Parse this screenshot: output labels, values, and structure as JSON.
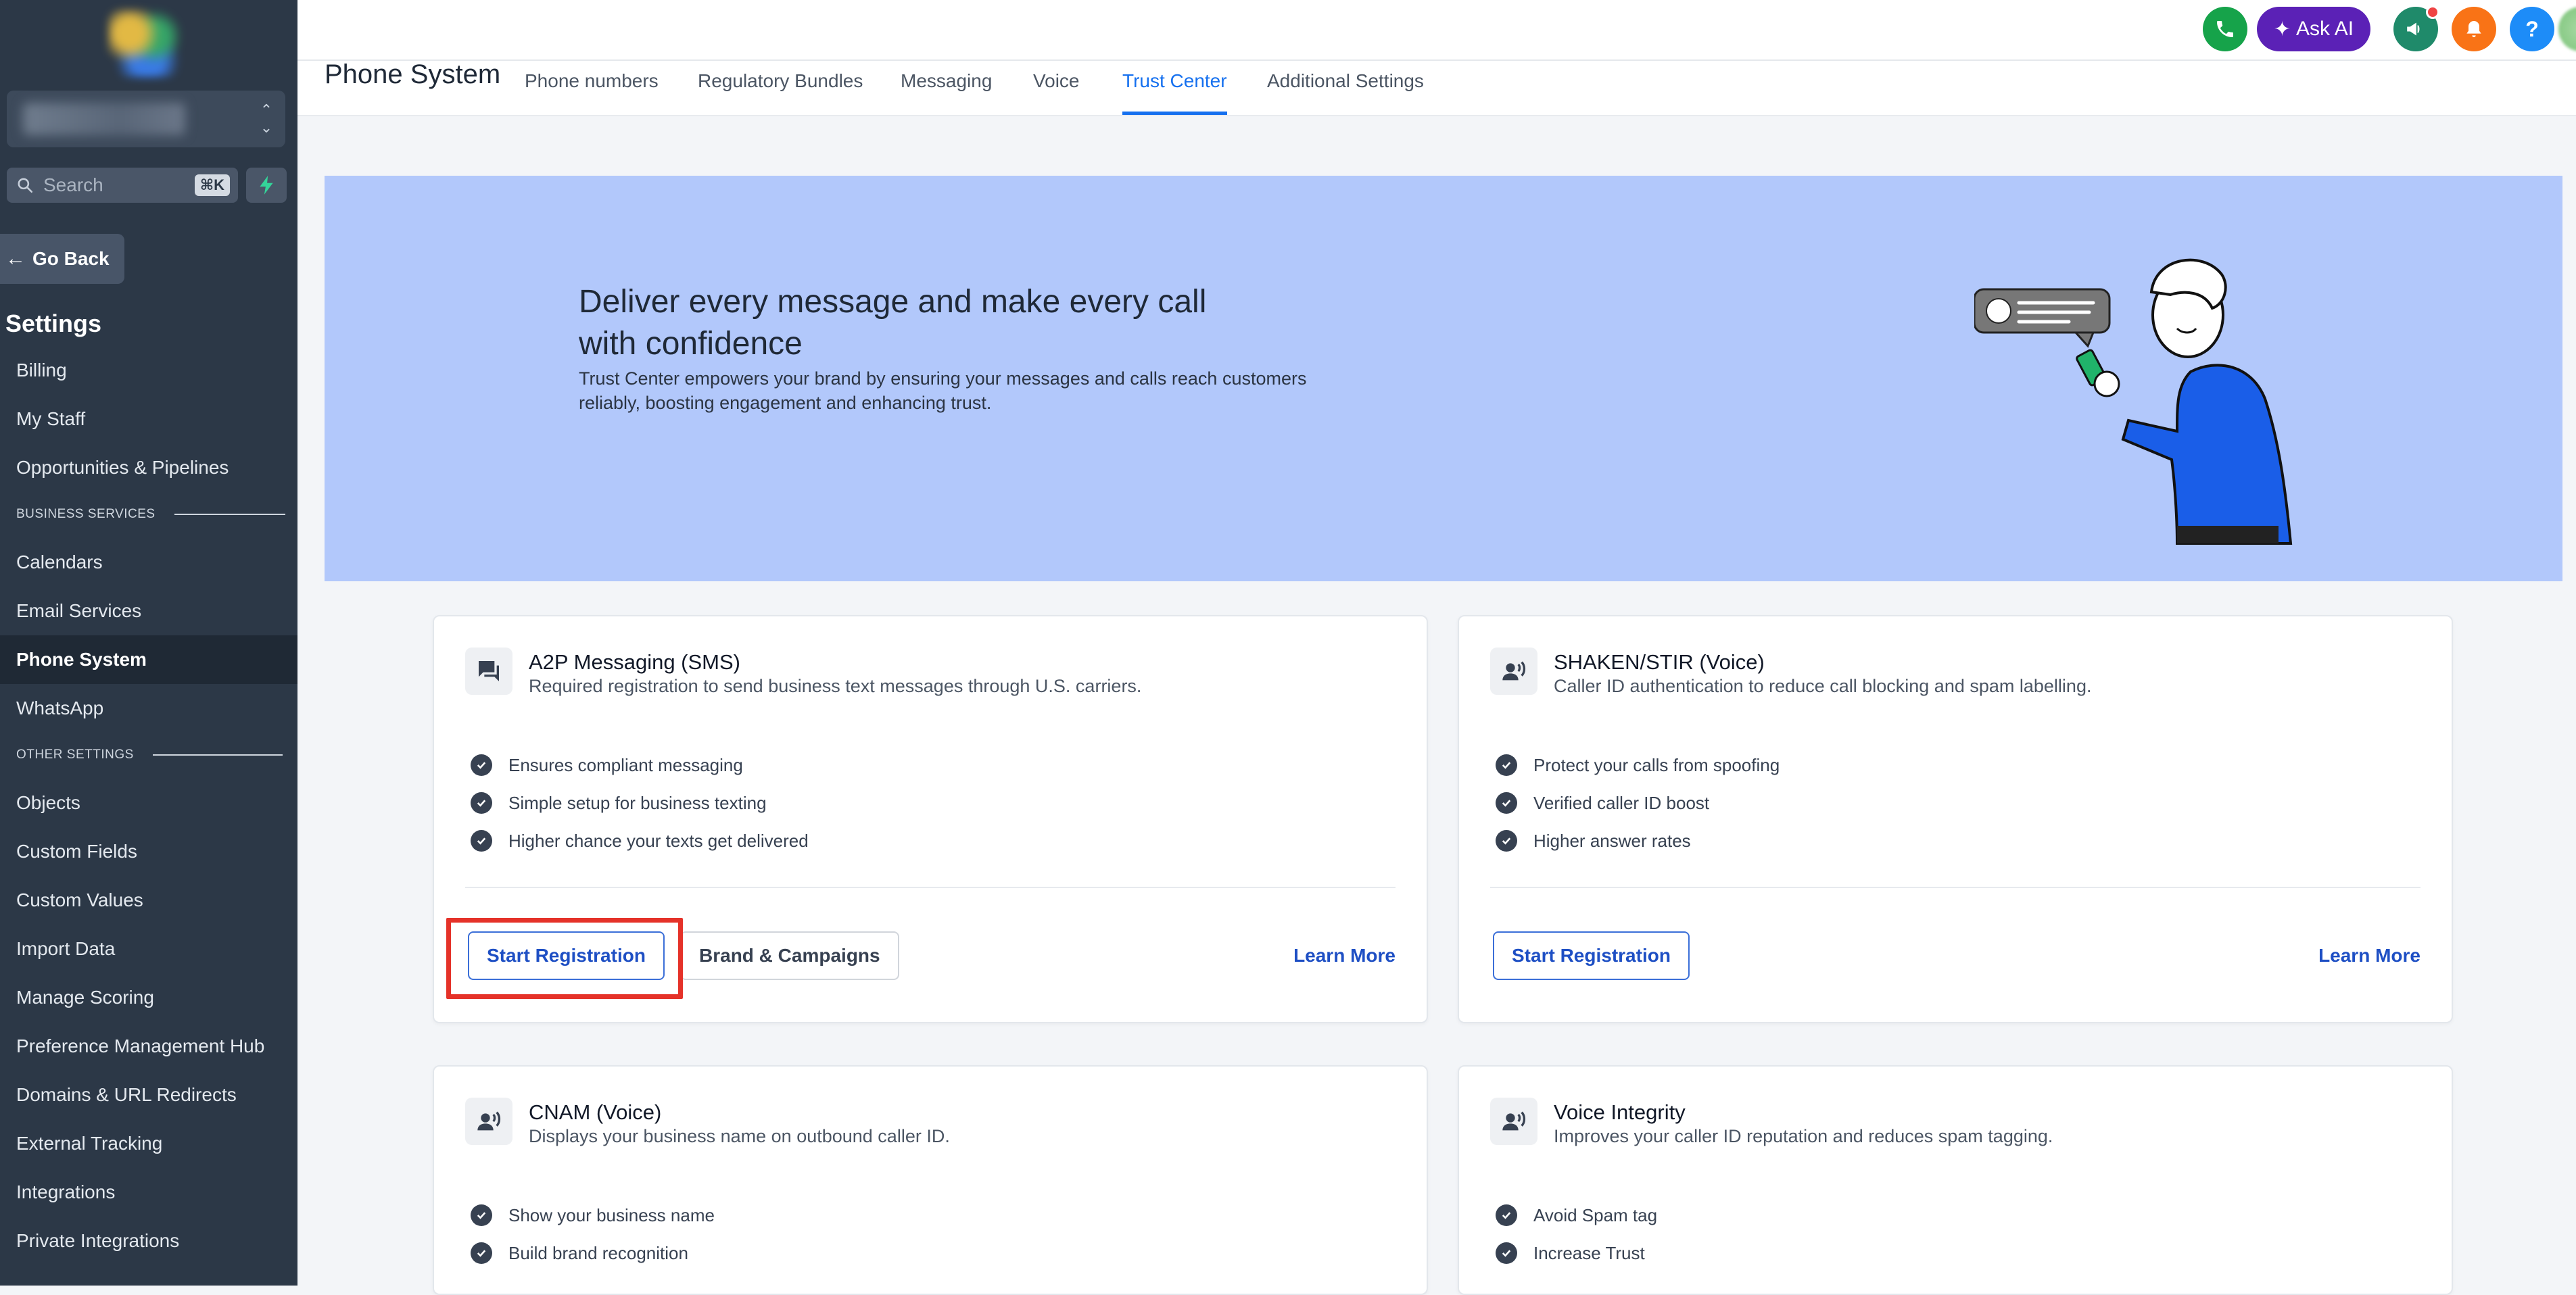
{
  "sidebar": {
    "search_placeholder": "Search",
    "search_shortcut": "⌘K",
    "go_back": "Go Back",
    "settings_title": "Settings",
    "items_top": [
      {
        "label": "Billing"
      },
      {
        "label": "My Staff"
      },
      {
        "label": "Opportunities & Pipelines"
      }
    ],
    "section_business": "BUSINESS SERVICES",
    "items_business": [
      {
        "label": "Calendars"
      },
      {
        "label": "Email Services"
      },
      {
        "label": "Phone System",
        "active": true
      },
      {
        "label": "WhatsApp"
      }
    ],
    "section_other": "OTHER SETTINGS",
    "items_other": [
      {
        "label": "Objects"
      },
      {
        "label": "Custom Fields"
      },
      {
        "label": "Custom Values"
      },
      {
        "label": "Import Data"
      },
      {
        "label": "Manage Scoring"
      },
      {
        "label": "Preference Management Hub"
      },
      {
        "label": "Domains & URL Redirects"
      },
      {
        "label": "External Tracking"
      },
      {
        "label": "Integrations"
      },
      {
        "label": "Private Integrations"
      }
    ]
  },
  "header": {
    "page_title": "Phone System",
    "tabs": [
      {
        "label": "Phone numbers"
      },
      {
        "label": "Regulatory Bundles"
      },
      {
        "label": "Messaging"
      },
      {
        "label": "Voice"
      },
      {
        "label": "Trust Center",
        "active": true
      },
      {
        "label": "Additional Settings"
      }
    ],
    "ask_ai": "Ask AI",
    "help": "?"
  },
  "hero": {
    "title": "Deliver every message and make every call with confidence",
    "text": "Trust Center empowers your brand by ensuring your messages and calls reach customers reliably, boosting engagement and enhancing trust."
  },
  "cards": [
    {
      "title": "A2P Messaging (SMS)",
      "subtitle": "Required registration to send business text messages through U.S. carriers.",
      "features": [
        "Ensures compliant messaging",
        "Simple setup for business texting",
        "Higher chance your texts get delivered"
      ],
      "primary_button": "Start Registration",
      "secondary_button": "Brand & Campaigns",
      "link": "Learn More"
    },
    {
      "title": "SHAKEN/STIR (Voice)",
      "subtitle": "Caller ID authentication to reduce call blocking and spam labelling.",
      "features": [
        "Protect your calls from spoofing",
        "Verified caller ID boost",
        "Higher answer rates"
      ],
      "primary_button": "Start Registration",
      "link": "Learn More"
    },
    {
      "title": "CNAM (Voice)",
      "subtitle": "Displays your business name on outbound caller ID.",
      "features": [
        "Show your business name",
        "Build brand recognition"
      ]
    },
    {
      "title": "Voice Integrity",
      "subtitle": "Improves your caller ID reputation and reduces spam tagging.",
      "features": [
        "Avoid Spam tag",
        "Increase Trust"
      ]
    }
  ],
  "colors": {
    "accent": "#1570ef",
    "sidebar_bg": "#2c3847",
    "hero_bg": "#b2c8fb",
    "highlight": "#e53229"
  }
}
